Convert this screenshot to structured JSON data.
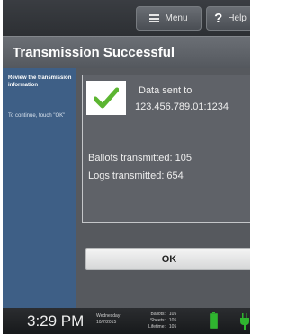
{
  "toolbar": {
    "menu_label": "Menu",
    "help_label": "Help",
    "help_icon_glyph": "?"
  },
  "dialog": {
    "title": "Transmission Successful"
  },
  "sidebar": {
    "instruction": "Review the transmission information",
    "continue_note": "To continue, touch \"OK\""
  },
  "result": {
    "sent_label": "Data sent to",
    "address": "123.456.789.01:1234",
    "ballots": "Ballots transmitted: 105",
    "logs": "Logs transmitted: 654",
    "status_icon": "checkmark-icon"
  },
  "ok_label": "OK",
  "statusbar": {
    "time": "3:29 PM",
    "day": "Wednesday",
    "date": "10/7/2015",
    "counts": [
      {
        "label": "Ballots:",
        "value": "105"
      },
      {
        "label": "Sheets:",
        "value": "105"
      },
      {
        "label": "Lifetime:",
        "value": "105"
      }
    ],
    "battery_icon": "battery-icon",
    "power_icon": "plug-icon"
  },
  "colors": {
    "sidebar": "#3e5f86",
    "check": "#5cb531",
    "background": "#4d5157"
  }
}
